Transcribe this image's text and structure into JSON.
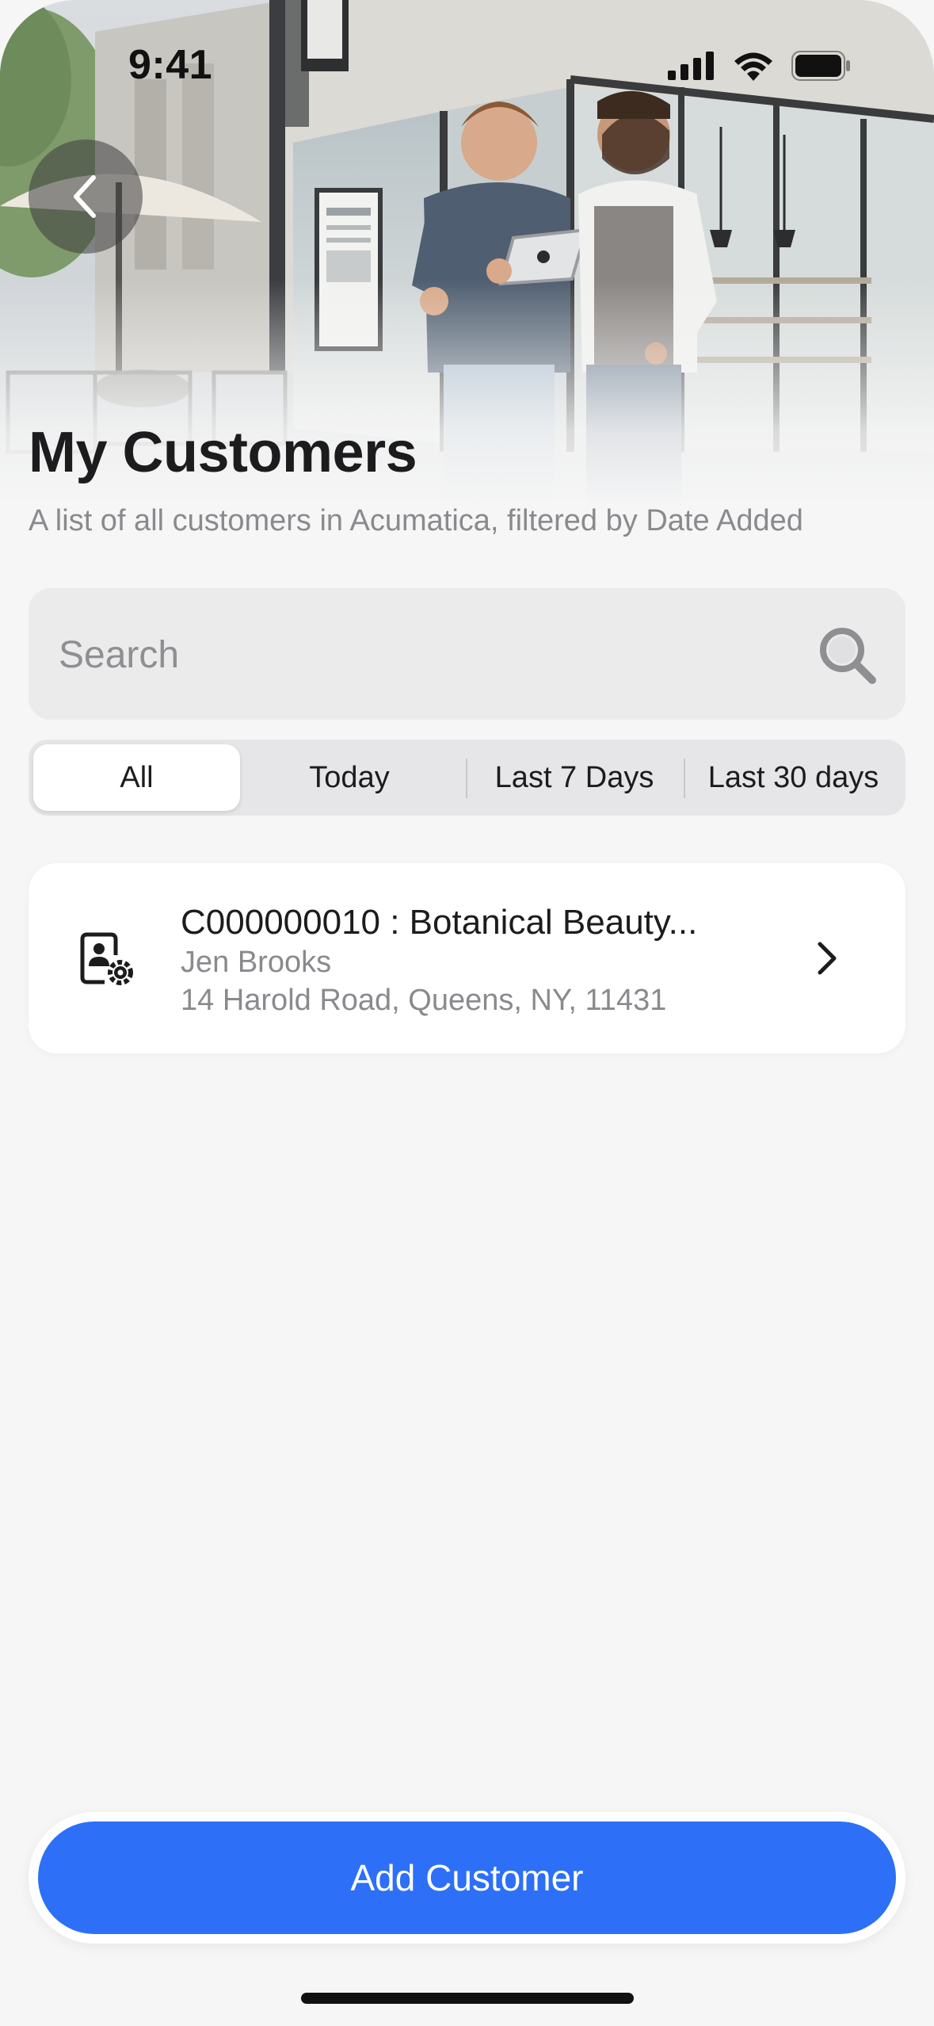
{
  "status_bar": {
    "time": "9:41"
  },
  "header": {
    "title": "My Customers",
    "subtitle": "A list of all customers in Acumatica, filtered by Date Added"
  },
  "search": {
    "placeholder": "Search",
    "value": ""
  },
  "filters": {
    "selected": "All",
    "tabs": [
      {
        "label": "All"
      },
      {
        "label": "Today"
      },
      {
        "label": "Last 7 Days"
      },
      {
        "label": "Last 30 days"
      }
    ]
  },
  "customers": [
    {
      "title": "C000000010 : Botanical Beauty...",
      "contact": "Jen Brooks",
      "address": "14 Harold Road, Queens, NY, 11431",
      "icon": "customer-settings-icon"
    }
  ],
  "actions": {
    "add_customer_label": "Add Customer"
  },
  "colors": {
    "accent": "#2d6ff6",
    "background": "#f6f6f6",
    "card": "#ffffff",
    "secondary_text": "#8a8a8e"
  },
  "icons": {
    "back": "chevron-left-icon",
    "search": "magnifier-icon",
    "row_chevron": "chevron-right-icon",
    "signal": "cellular-signal-icon",
    "wifi": "wifi-icon",
    "battery": "battery-icon"
  }
}
